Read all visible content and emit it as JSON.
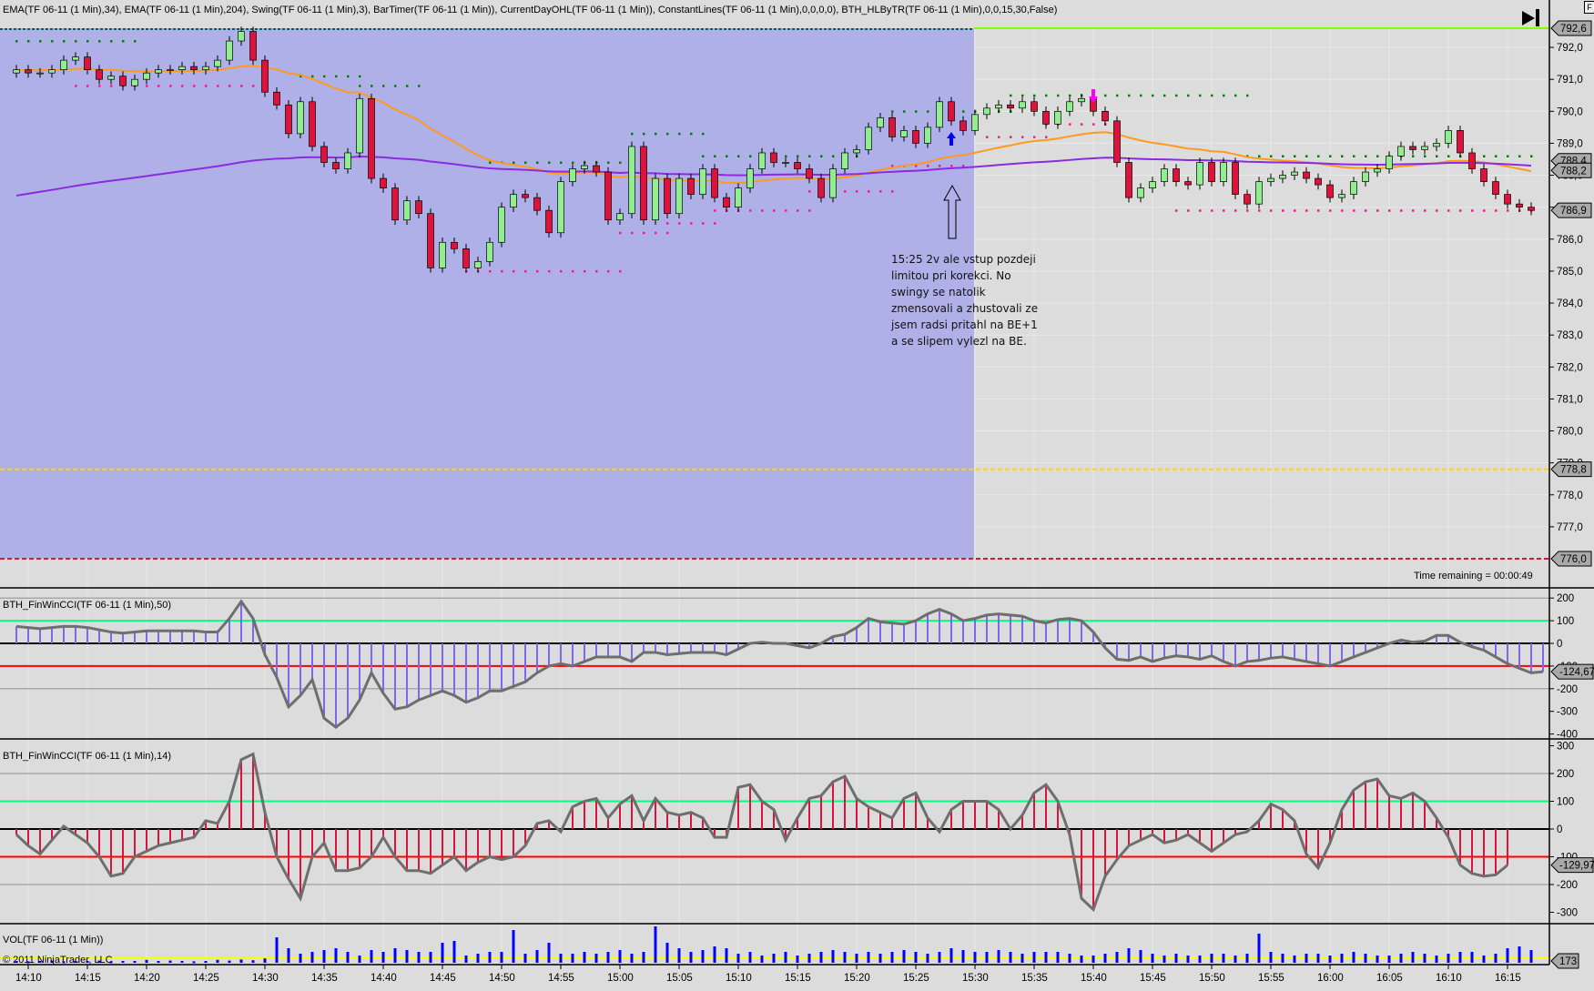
{
  "header": {
    "indicators_label": "EMA(TF 06-11 (1 Min),34), EMA(TF 06-11 (1 Min),204), Swing(TF 06-11 (1 Min),3), BarTimer(TF 06-11 (1 Min)), CurrentDayOHL(TF 06-11 (1 Min)), ConstantLines(TF 06-11 (1 Min),0,0,0,0), BTH_HLByTR(TF 06-11 (1 Min),0,0,15,30,False)",
    "f_button": "F"
  },
  "annotation": "15:25 2v ale vstup pozdeji limitou pri korekci. No swingy se natolik zmensovali a zhustovali ze jsem radsi pritahl na BE+1 a se slipem vylezl na BE.",
  "bar_timer": "Time remaining = 00:00:49",
  "copyright": "© 2011 NinjaTrader, LLC",
  "colors": {
    "up": "#90ee90",
    "down": "#dc143c",
    "ema34": "#ff9a1f",
    "ema204": "#8a2be2",
    "shade": "#b0b0e8",
    "cci1": "#7b68ee",
    "cci2": "#dc143c",
    "cci_line": "#6e6e6e",
    "vol": "#0000ff",
    "high": "#7fff00",
    "low": "#dc143c",
    "open": "#ffd700"
  },
  "price_axis": {
    "ticks": [
      "792,0",
      "791,0",
      "790,0",
      "789,0",
      "788,0",
      "787,0",
      "786,0",
      "785,0",
      "784,0",
      "783,0",
      "782,0",
      "781,0",
      "780,0",
      "779,0",
      "778,0",
      "777,0"
    ],
    "markers": [
      {
        "label": "792,6",
        "value": 792.6,
        "color": "#7fff00"
      },
      {
        "label": "788,4",
        "value": 788.45,
        "color": "#8a2be2"
      },
      {
        "label": "788,2",
        "value": 788.15,
        "color": "#ff9a1f"
      },
      {
        "label": "786,9",
        "value": 786.9,
        "color": "#000000"
      },
      {
        "label": "778,8",
        "value": 778.8,
        "color": "#ffd700"
      },
      {
        "label": "776,0",
        "value": 776.0,
        "color": "#dc143c"
      }
    ]
  },
  "time_axis": [
    "14:10",
    "14:15",
    "14:20",
    "14:25",
    "14:30",
    "14:35",
    "14:40",
    "14:45",
    "14:50",
    "14:55",
    "15:00",
    "15:05",
    "15:10",
    "15:15",
    "15:20",
    "15:25",
    "15:30",
    "15:35",
    "15:40",
    "15:45",
    "15:50",
    "15:55",
    "16:00",
    "16:05",
    "16:10",
    "16:15"
  ],
  "closes": [
    791.3,
    791.2,
    791.2,
    791.3,
    791.6,
    791.7,
    791.3,
    791.0,
    791.1,
    790.8,
    791.0,
    791.2,
    791.3,
    791.3,
    791.4,
    791.3,
    791.4,
    791.6,
    792.2,
    792.5,
    791.6,
    790.6,
    790.2,
    789.3,
    790.3,
    788.9,
    788.4,
    788.2,
    788.7,
    790.4,
    787.9,
    787.6,
    786.6,
    787.2,
    786.8,
    785.1,
    785.9,
    785.7,
    785.1,
    785.3,
    785.9,
    787.0,
    787.4,
    787.3,
    786.9,
    786.2,
    787.8,
    788.2,
    788.3,
    788.1,
    786.6,
    786.8,
    788.9,
    786.6,
    787.9,
    786.8,
    787.9,
    787.4,
    788.2,
    787.3,
    787.0,
    787.6,
    788.2,
    788.7,
    788.4,
    788.4,
    788.2,
    787.9,
    787.3,
    788.2,
    788.7,
    788.8,
    789.5,
    789.8,
    789.2,
    789.4,
    789.0,
    789.5,
    790.3,
    789.7,
    789.4,
    789.9,
    790.1,
    790.2,
    790.1,
    790.3,
    790.0,
    789.6,
    790.0,
    790.3,
    790.4,
    790.0,
    789.7,
    788.4,
    787.3,
    787.6,
    787.8,
    788.2,
    787.8,
    787.7,
    788.4,
    787.8,
    788.4,
    787.4,
    787.1,
    787.8,
    787.9,
    788.0,
    788.1,
    787.9,
    787.7,
    787.3,
    787.4,
    787.8,
    788.1,
    788.2,
    788.6,
    788.9,
    788.8,
    788.9,
    789.0,
    789.4,
    788.7,
    788.2,
    787.8,
    787.4,
    787.1,
    787.0,
    786.9
  ],
  "ema204_seed": 787.3,
  "swings": [
    {
      "type": "high",
      "value": 792.2,
      "from": 0,
      "to": 10
    },
    {
      "type": "low",
      "value": 790.8,
      "from": 5,
      "to": 20
    },
    {
      "type": "high",
      "value": 791.1,
      "from": 24,
      "to": 29
    },
    {
      "type": "high",
      "value": 790.8,
      "from": 29,
      "to": 34
    },
    {
      "type": "high",
      "value": 788.4,
      "from": 40,
      "to": 52
    },
    {
      "type": "low",
      "value": 785.0,
      "from": 38,
      "to": 51
    },
    {
      "type": "high",
      "value": 789.3,
      "from": 52,
      "to": 58
    },
    {
      "type": "low",
      "value": 786.2,
      "from": 51,
      "to": 55
    },
    {
      "type": "high",
      "value": 788.6,
      "from": 58,
      "to": 71
    },
    {
      "type": "low",
      "value": 786.5,
      "from": 55,
      "to": 59
    },
    {
      "type": "low",
      "value": 786.9,
      "from": 59,
      "to": 67
    },
    {
      "type": "low",
      "value": 787.5,
      "from": 67,
      "to": 74
    },
    {
      "type": "high",
      "value": 790.0,
      "from": 74,
      "to": 84
    },
    {
      "type": "low",
      "value": 788.3,
      "from": 74,
      "to": 80
    },
    {
      "type": "low",
      "value": 789.2,
      "from": 82,
      "to": 87
    },
    {
      "type": "high",
      "value": 790.5,
      "from": 84,
      "to": 104
    },
    {
      "type": "low",
      "value": 789.6,
      "from": 87,
      "to": 93
    },
    {
      "type": "high",
      "value": 788.6,
      "from": 104,
      "to": 128
    },
    {
      "type": "low",
      "value": 786.9,
      "from": 98,
      "to": 128
    }
  ],
  "levels": {
    "high": 792.6,
    "open": 778.8,
    "low": 776.0
  },
  "cci1": {
    "label": "BTH_FinWinCCI(TF 06-11 (1 Min),50)",
    "ticks": [
      "200",
      "100",
      "0",
      "-100",
      "-200",
      "-300",
      "-400"
    ],
    "last": "-124,67",
    "values": [
      75,
      70,
      65,
      70,
      75,
      75,
      70,
      60,
      50,
      45,
      50,
      55,
      55,
      55,
      55,
      55,
      50,
      50,
      110,
      185,
      110,
      -50,
      -150,
      -280,
      -230,
      -160,
      -330,
      -370,
      -330,
      -250,
      -130,
      -220,
      -290,
      -280,
      -250,
      -230,
      -210,
      -230,
      -260,
      -240,
      -210,
      -210,
      -190,
      -170,
      -130,
      -100,
      -90,
      -100,
      -80,
      -60,
      -60,
      -60,
      -80,
      -40,
      -40,
      -50,
      -45,
      -40,
      -40,
      -40,
      -50,
      -25,
      0,
      5,
      0,
      0,
      -10,
      -20,
      0,
      30,
      40,
      70,
      110,
      95,
      90,
      85,
      100,
      130,
      150,
      130,
      100,
      110,
      125,
      130,
      125,
      120,
      100,
      90,
      105,
      110,
      100,
      50,
      -20,
      -70,
      -75,
      -60,
      -80,
      -65,
      -55,
      -60,
      -70,
      -55,
      -80,
      -100,
      -80,
      -75,
      -65,
      -60,
      -70,
      -80,
      -90,
      -100,
      -80,
      -60,
      -40,
      -20,
      0,
      15,
      5,
      10,
      35,
      35,
      5,
      -15,
      -30,
      -60,
      -90,
      -110,
      -130,
      -125
    ]
  },
  "cci2": {
    "label": "BTH_FinWinCCI(TF 06-11 (1 Min),14)",
    "ticks": [
      "300",
      "200",
      "100",
      "0",
      "-100",
      "-200",
      "-300"
    ],
    "last": "-129,97",
    "values": [
      -20,
      -60,
      -90,
      -40,
      10,
      -20,
      -50,
      -100,
      -170,
      -160,
      -100,
      -80,
      -60,
      -50,
      -40,
      -30,
      30,
      20,
      100,
      250,
      270,
      60,
      -100,
      -180,
      -250,
      -100,
      -50,
      -150,
      -150,
      -140,
      -100,
      -30,
      -100,
      -150,
      -150,
      -160,
      -130,
      -100,
      -150,
      -120,
      -100,
      -110,
      -100,
      -60,
      20,
      30,
      -10,
      80,
      100,
      110,
      40,
      90,
      120,
      30,
      110,
      60,
      50,
      60,
      40,
      -30,
      -30,
      150,
      160,
      100,
      70,
      -40,
      40,
      110,
      120,
      170,
      190,
      110,
      80,
      60,
      40,
      110,
      130,
      40,
      -10,
      70,
      100,
      100,
      100,
      70,
      0,
      50,
      130,
      160,
      100,
      -20,
      -250,
      -290,
      -170,
      -110,
      -60,
      -40,
      -20,
      -50,
      -40,
      -20,
      -50,
      -80,
      -50,
      -20,
      -10,
      30,
      90,
      70,
      30,
      -90,
      -140,
      -50,
      70,
      140,
      170,
      180,
      120,
      110,
      130,
      100,
      40,
      -30,
      -130,
      -160,
      -170,
      -165,
      -130
    ]
  },
  "vol": {
    "label": "VOL(TF 06-11 (1 Min))",
    "last": "173",
    "values": [
      5,
      4,
      5,
      6,
      4,
      5,
      5,
      6,
      4,
      5,
      5,
      8,
      5,
      6,
      5,
      4,
      5,
      8,
      6,
      9,
      7,
      12,
      70,
      40,
      25,
      30,
      35,
      40,
      30,
      20,
      35,
      30,
      40,
      35,
      30,
      30,
      55,
      60,
      20,
      25,
      30,
      30,
      90,
      25,
      35,
      55,
      25,
      25,
      30,
      25,
      30,
      35,
      25,
      30,
      100,
      55,
      40,
      30,
      35,
      45,
      40,
      25,
      30,
      20,
      25,
      30,
      20,
      25,
      30,
      35,
      30,
      25,
      30,
      25,
      30,
      35,
      30,
      25,
      30,
      40,
      35,
      30,
      30,
      35,
      30,
      25,
      30,
      30,
      30,
      25,
      20,
      20,
      25,
      30,
      40,
      35,
      25,
      20,
      25,
      20,
      20,
      25,
      25,
      20,
      25,
      80,
      30,
      25,
      20,
      25,
      25,
      20,
      25,
      30,
      25,
      20,
      20,
      25,
      30,
      25,
      20,
      25,
      30,
      30,
      20,
      25,
      40,
      45,
      35
    ]
  }
}
